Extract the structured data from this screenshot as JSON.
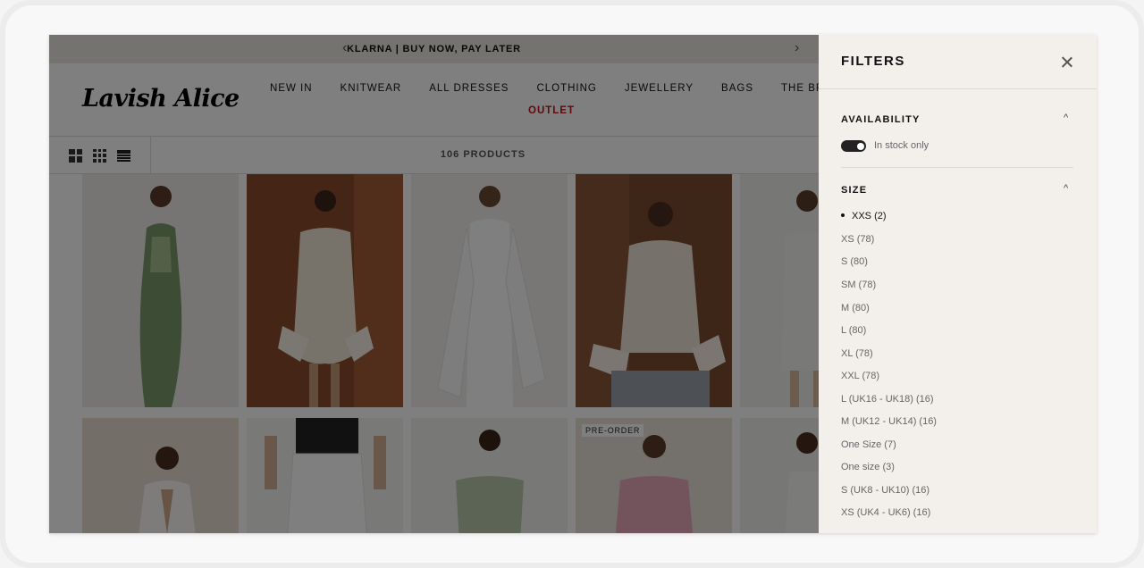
{
  "announcement": {
    "text": "KLARNA | BUY NOW, PAY LATER",
    "prev": "‹",
    "next": "›"
  },
  "logo": "Lavish Alice",
  "nav": {
    "items": [
      "NEW IN",
      "KNITWEAR",
      "ALL DRESSES",
      "CLOTHING",
      "JEWELLERY",
      "BAGS",
      "THE BRIDAL SALON"
    ],
    "outlet": "OUTLET"
  },
  "toolbar": {
    "product_count": "106 PRODUCTS"
  },
  "products": {
    "badge": "PRE-ORDER"
  },
  "filters": {
    "title": "FILTERS",
    "availability": {
      "title": "AVAILABILITY",
      "toggle_label": "In stock only",
      "caret": "^"
    },
    "size": {
      "title": "SIZE",
      "caret": "^",
      "options": [
        "XXS (2)",
        "XS (78)",
        "S (80)",
        "SM (78)",
        "M (80)",
        "L (80)",
        "XL (78)",
        "XXL (78)",
        "L (UK16 - UK18) (16)",
        "M (UK12 - UK14) (16)",
        "One Size (7)",
        "One size (3)",
        "S (UK8 - UK10) (16)",
        "XS (UK4 - UK6) (16)"
      ]
    }
  },
  "colors": {
    "outlet": "#c0151a",
    "panel_bg": "#f3f0eb"
  }
}
